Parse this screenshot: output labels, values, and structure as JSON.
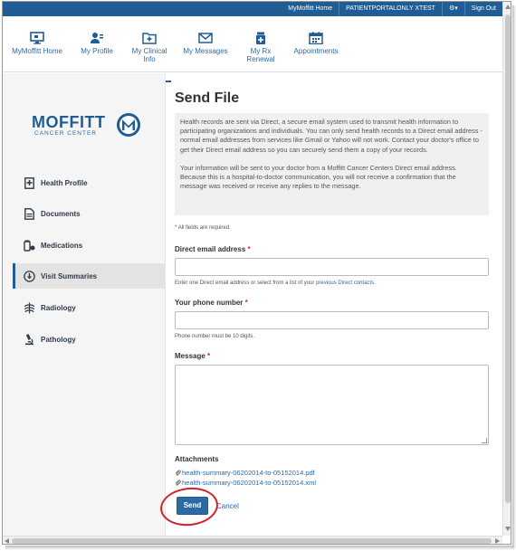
{
  "topbar": {
    "home": "MyMoffitt Home",
    "user": "PATIENTPORTALONLY XTEST",
    "settings_caret": "▾",
    "signout": "Sign Out"
  },
  "nav": {
    "items": [
      {
        "label": "MyMoffitt Home",
        "icon": "monitor-icon"
      },
      {
        "label": "My Profile",
        "icon": "user-card-icon"
      },
      {
        "label": "My Clinical Info",
        "icon": "folder-plus-icon",
        "active": true
      },
      {
        "label": "My Messages",
        "icon": "envelope-icon"
      },
      {
        "label": "My Rx Renewal",
        "icon": "pill-bottle-icon"
      },
      {
        "label": "Appointments",
        "icon": "calendar-icon"
      }
    ]
  },
  "logo": {
    "name": "MOFFITT",
    "sub": "CANCER CENTER"
  },
  "sidebar": {
    "items": [
      {
        "label": "Health Profile",
        "icon": "medical-file-icon"
      },
      {
        "label": "Documents",
        "icon": "document-icon"
      },
      {
        "label": "Medications",
        "icon": "medications-icon"
      },
      {
        "label": "Visit Summaries",
        "icon": "download-circle-icon",
        "active": true
      },
      {
        "label": "Radiology",
        "icon": "ribcage-icon"
      },
      {
        "label": "Pathology",
        "icon": "microscope-icon"
      }
    ]
  },
  "main": {
    "title": "Send File",
    "info_p1": "Health records are sent via Direct, a secure email system used to transmit health information to participating organizations and individuals. You can only send health records to a Direct email address - normal email addresses from services like Gmail or Yahoo will not work. Contact your doctor's office to get their Direct email address so you can securely send them a copy of your records.",
    "info_p2": "Your information will be sent to your doctor from a Moffitt Cancer Centers Direct email address. Because this is a hospital-to-doctor communication, you will not receive a confirmation that the message was received or receive any replies to the message.",
    "required_note": "All fields are required.",
    "email_label": "Direct email address",
    "email_value": "",
    "email_help_prefix": "Enter one Direct email address or select from a list of your ",
    "email_help_link": "previous Direct contacts",
    "email_help_suffix": ".",
    "phone_label": "Your phone number",
    "phone_value": "",
    "phone_help": "Phone number must be 10 digits.",
    "message_label": "Message",
    "message_value": "",
    "attachments_label": "Attachments",
    "attachments": [
      "health-summary-06202014-to-05152014.pdf",
      "health-summary-06202014-to-05152014.xml"
    ],
    "send_label": "Send",
    "cancel_label": "Cancel",
    "required_star": "*"
  },
  "colors": {
    "brand": "#1f5d94",
    "link": "#2d6aa3",
    "highlight_circle": "#d4202a"
  }
}
